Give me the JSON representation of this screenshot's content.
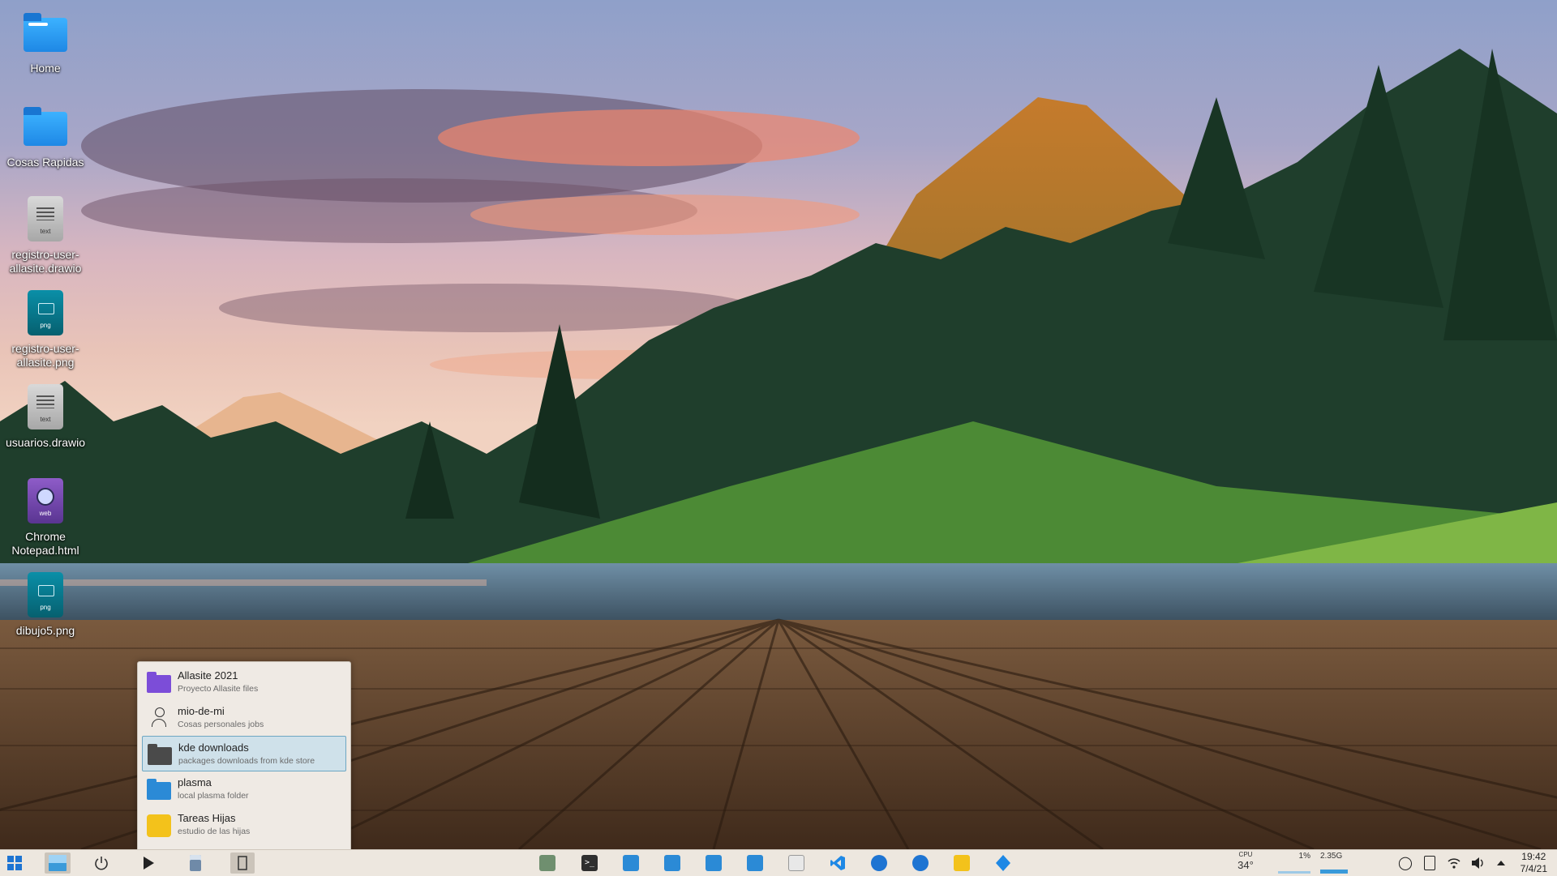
{
  "desktop": {
    "icons": [
      {
        "label": "Home",
        "type": "folder-home",
        "icon": "home-folder-icon"
      },
      {
        "label": "Cosas Rapidas",
        "type": "folder",
        "icon": "folder-icon"
      },
      {
        "label": "registro-user-allasite.drawio",
        "type": "text",
        "tag": "text",
        "icon": "text-file-icon"
      },
      {
        "label": "registro-user-allasite.png",
        "type": "png",
        "tag": "png",
        "icon": "image-file-icon"
      },
      {
        "label": "usuarios.drawio",
        "type": "text",
        "tag": "text",
        "icon": "text-file-icon"
      },
      {
        "label": "Chrome Notepad.html",
        "type": "web",
        "tag": "web",
        "icon": "web-file-icon"
      },
      {
        "label": "dibujo5.png",
        "type": "png",
        "tag": "png",
        "icon": "image-file-icon"
      }
    ]
  },
  "activities": {
    "items": [
      {
        "name": "Allasite 2021",
        "desc": "Proyecto Allasite files",
        "icon": "purple-folder-icon",
        "color": "#7c4dd8"
      },
      {
        "name": "mio-de-mi",
        "desc": "Cosas personales jobs",
        "icon": "user-icon",
        "color": "#333333"
      },
      {
        "name": "kde downloads",
        "desc": "packages downloads from kde store",
        "icon": "dark-folder-icon",
        "color": "#4a4a4a",
        "selected": true
      },
      {
        "name": "plasma",
        "desc": "local plasma folder",
        "icon": "blue-folder-icon",
        "color": "#2b8ad6"
      },
      {
        "name": "Tareas Hijas",
        "desc": "estudio de las hijas",
        "icon": "yellow-notes-icon",
        "color": "#f3c21b"
      }
    ]
  },
  "taskbar": {
    "left": [
      {
        "icon": "app-launcher-icon"
      },
      {
        "icon": "activities-switcher-icon",
        "active": true
      },
      {
        "icon": "power-icon"
      },
      {
        "icon": "play-icon"
      },
      {
        "icon": "calculator-icon"
      },
      {
        "icon": "bookmark-icon",
        "active": true
      }
    ],
    "tasks": [
      {
        "icon": "system-monitor-icon",
        "color": "#6f8f6f"
      },
      {
        "icon": "terminal-icon",
        "color": "#2f2f2f"
      },
      {
        "icon": "file-manager-icon",
        "color": "#2b8ad6"
      },
      {
        "icon": "file-manager-icon",
        "color": "#2b8ad6"
      },
      {
        "icon": "file-manager-icon",
        "color": "#2b8ad6"
      },
      {
        "icon": "file-manager-icon",
        "color": "#2b8ad6"
      },
      {
        "icon": "text-editor-icon",
        "color": "#e8e8e8"
      },
      {
        "icon": "vscode-icon",
        "color": "#1e88e5"
      },
      {
        "icon": "chromium-icon",
        "color": "#1e74d2"
      },
      {
        "icon": "chromium-icon",
        "color": "#1e74d2"
      },
      {
        "icon": "notes-icon",
        "color": "#f3c21b"
      },
      {
        "icon": "kde-connect-icon",
        "color": "#1e88e5"
      }
    ],
    "tray": {
      "cpu_label": "CPU",
      "cpu_temp": "34°",
      "cpu_load": "1%",
      "memory": "2.35G",
      "icons": [
        "lightbulb-icon",
        "clipboard-icon",
        "network-icon",
        "volume-icon",
        "arrow-up-icon"
      ]
    },
    "clock": {
      "time": "19:42",
      "date": "7/4/21"
    }
  }
}
